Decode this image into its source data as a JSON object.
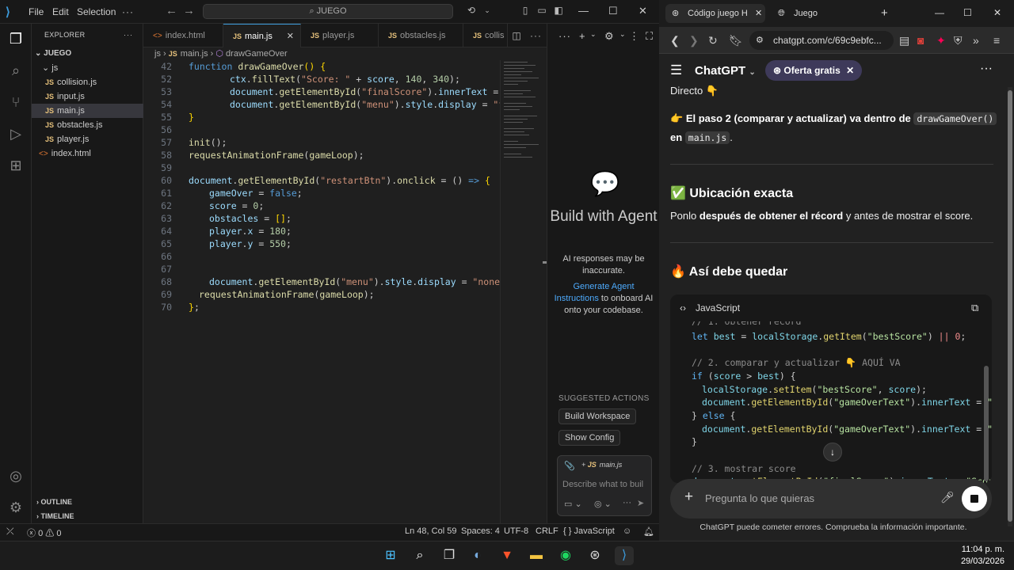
{
  "vscode": {
    "menu": [
      "File",
      "Edit",
      "Selection"
    ],
    "search": "JUEGO",
    "explorer_title": "EXPLORER",
    "root": "JUEGO",
    "tree": [
      {
        "label": "js",
        "type": "folder"
      },
      {
        "label": "collision.js",
        "type": "js"
      },
      {
        "label": "input.js",
        "type": "js"
      },
      {
        "label": "main.js",
        "type": "js",
        "selected": true
      },
      {
        "label": "obstacles.js",
        "type": "js"
      },
      {
        "label": "player.js",
        "type": "js"
      },
      {
        "label": "index.html",
        "type": "html"
      }
    ],
    "outline": "OUTLINE",
    "timeline": "TIMELINE",
    "tabs": [
      "index.html",
      "main.js",
      "player.js",
      "obstacles.js",
      "collis"
    ],
    "breadcrumb": {
      "folder": "js",
      "file": "main.js",
      "symbol": "drawGameOver"
    },
    "line_numbers": [
      "42",
      "52",
      "53",
      "54",
      "55",
      "56",
      "57",
      "58",
      "59",
      "60",
      "61",
      "62",
      "63",
      "64",
      "65",
      "66",
      "67",
      "68",
      "69",
      "70"
    ],
    "agent": {
      "title": "Build with Agent",
      "subtitle": "AI responses may be inaccurate.",
      "link": "Generate Agent Instructions",
      "tail": "to onboard AI onto your codebase.",
      "suggested": "SUGGESTED ACTIONS",
      "btn1": "Build Workspace",
      "btn2": "Show Config",
      "chip": "main.js",
      "placeholder": "Describe what to buil"
    },
    "status": {
      "errors": "0",
      "warnings": "0",
      "position": "Ln 48, Col 59",
      "spaces": "Spaces: 4",
      "encoding": "UTF-8",
      "eol": "CRLF",
      "language": "JavaScript"
    }
  },
  "browser": {
    "tab1": "Código juego H",
    "tab2": "Juego",
    "url": "chatgpt.com/c/69c9ebfc...",
    "app": "ChatGPT",
    "offer": "Oferta gratis",
    "msg_direct": "Directo 👇",
    "msg_step_a": "👉 ",
    "msg_step_b": "El paso 2 (comparar y actualizar) va dentro de",
    "msg_step_code": "drawGameOver()",
    "msg_step_c": "en",
    "msg_step_code2": "main.js",
    "msg_step_d": ".",
    "h_ubicacion": "Ubicación exacta",
    "msg_ub_a": "Ponlo",
    "msg_ub_b": "después de obtener el récord",
    "msg_ub_c": "y antes de mostrar el score.",
    "h_asi": "Así debe quedar",
    "code_lang": "JavaScript",
    "prompt_placeholder": "Pregunta lo que quieras",
    "disclaimer": "ChatGPT puede cometer errores. Comprueba la información importante."
  },
  "taskbar": {
    "time": "11:04 p. m.",
    "date": "29/03/2026"
  }
}
